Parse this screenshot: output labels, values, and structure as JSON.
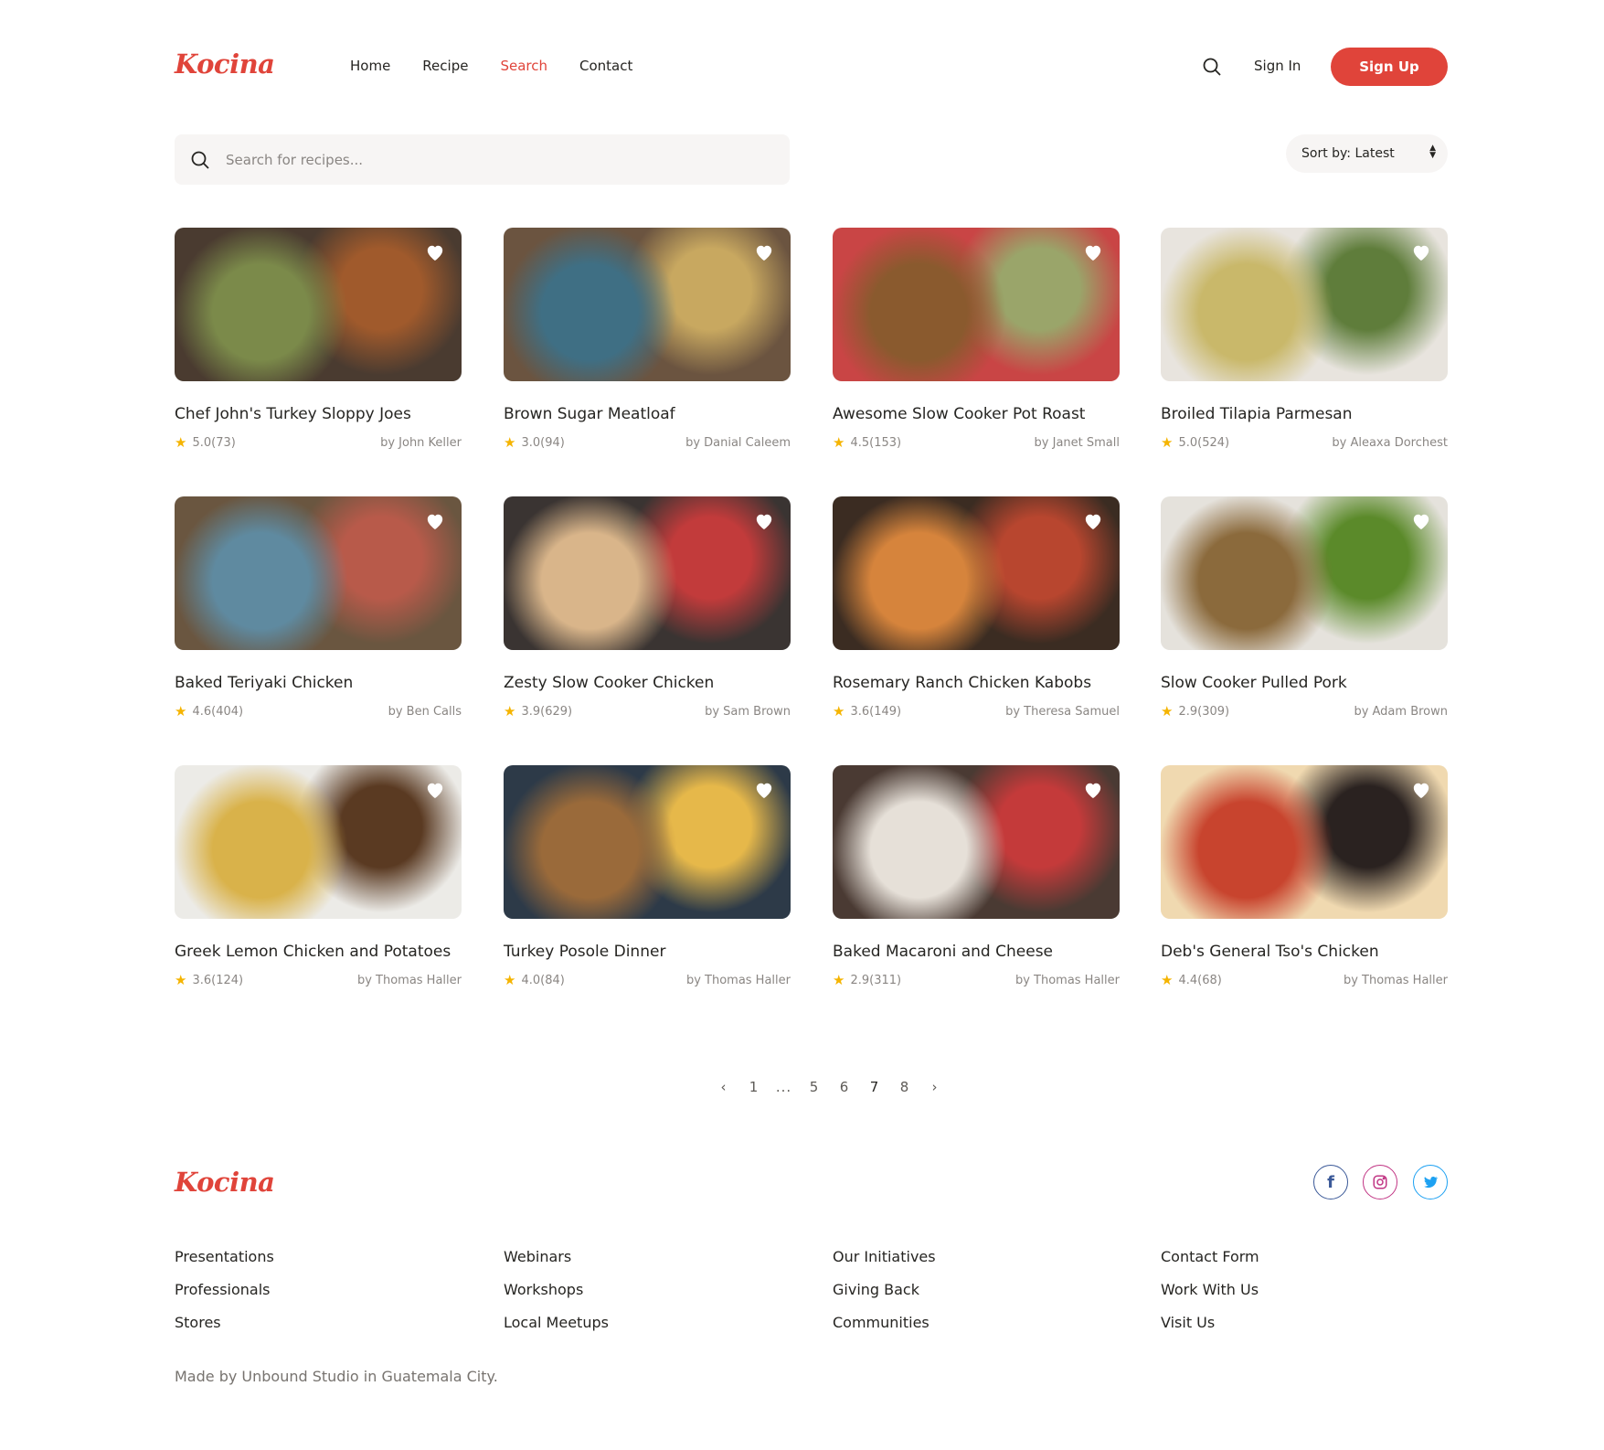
{
  "brand": {
    "name": "Kocina",
    "accent": "#e0443a"
  },
  "nav": {
    "items": [
      "Home",
      "Recipe",
      "Search",
      "Contact"
    ],
    "active": "Search",
    "sign_in": "Sign In",
    "sign_up": "Sign Up"
  },
  "search": {
    "placeholder": "Search for recipes...",
    "value": ""
  },
  "sort": {
    "label": "Sort by: Latest"
  },
  "recipes": [
    {
      "title": "Chef John's Turkey Sloppy Joes",
      "rating": "5.0(73)",
      "author": "by John Keller",
      "colors": [
        "#4a3b30",
        "#7b8a4a",
        "#a05a2c"
      ]
    },
    {
      "title": "Brown Sugar Meatloaf",
      "rating": "3.0(94)",
      "author": "by Danial Caleem",
      "colors": [
        "#6b5440",
        "#3f6f84",
        "#c8a860"
      ]
    },
    {
      "title": "Awesome Slow Cooker Pot Roast",
      "rating": "4.5(153)",
      "author": "by Janet Small",
      "colors": [
        "#c94545",
        "#8a5a2e",
        "#9aa56a"
      ]
    },
    {
      "title": "Broiled Tilapia Parmesan",
      "rating": "5.0(524)",
      "author": "by Aleaxa Dorchest",
      "colors": [
        "#e8e4de",
        "#c9b86a",
        "#5f7d3b"
      ]
    },
    {
      "title": "Baked Teriyaki Chicken",
      "rating": "4.6(404)",
      "author": "by Ben Calls",
      "colors": [
        "#6a5640",
        "#5f8aa0",
        "#b85a4a"
      ]
    },
    {
      "title": "Zesty Slow Cooker Chicken",
      "rating": "3.9(629)",
      "author": "by Sam Brown",
      "colors": [
        "#3a3432",
        "#d9b58a",
        "#c23b3b"
      ]
    },
    {
      "title": "Rosemary Ranch Chicken Kabobs",
      "rating": "3.6(149)",
      "author": "by Theresa Samuel",
      "colors": [
        "#3b2c22",
        "#d6843c",
        "#b8462f"
      ]
    },
    {
      "title": "Slow Cooker Pulled Pork",
      "rating": "2.9(309)",
      "author": "by Adam Brown",
      "colors": [
        "#e5e2dc",
        "#8b6a3c",
        "#5b8a2a"
      ]
    },
    {
      "title": "Greek Lemon Chicken and Potatoes",
      "rating": "3.6(124)",
      "author": "by Thomas Haller",
      "colors": [
        "#ecebe7",
        "#d9b24a",
        "#5a3a22"
      ]
    },
    {
      "title": "Turkey Posole Dinner",
      "rating": "4.0(84)",
      "author": "by Thomas Haller",
      "colors": [
        "#2d3a48",
        "#9a6a3a",
        "#e6b84a"
      ]
    },
    {
      "title": "Baked Macaroni and Cheese",
      "rating": "2.9(311)",
      "author": "by Thomas Haller",
      "colors": [
        "#4a3a33",
        "#e6e0d8",
        "#c43a3a"
      ]
    },
    {
      "title": "Deb's General Tso's Chicken",
      "rating": "4.4(68)",
      "author": "by Thomas Haller",
      "colors": [
        "#f0d9b0",
        "#c8442e",
        "#2a2220"
      ]
    }
  ],
  "pagination": {
    "prev": "‹",
    "pages": [
      "1",
      "...",
      "5",
      "6",
      "7",
      "8"
    ],
    "current": "7",
    "next": "›"
  },
  "footer": {
    "columns": [
      [
        "Presentations",
        "Professionals",
        "Stores"
      ],
      [
        "Webinars",
        "Workshops",
        "Local Meetups"
      ],
      [
        "Our Initiatives",
        "Giving Back",
        "Communities"
      ],
      [
        "Contact Form",
        "Work With Us",
        "Visit Us"
      ]
    ],
    "social": {
      "facebook": "f",
      "instagram_icon": "instagram-icon",
      "twitter_icon": "twitter-icon"
    },
    "copyright": "Made by Unbound Studio in Guatemala City."
  }
}
